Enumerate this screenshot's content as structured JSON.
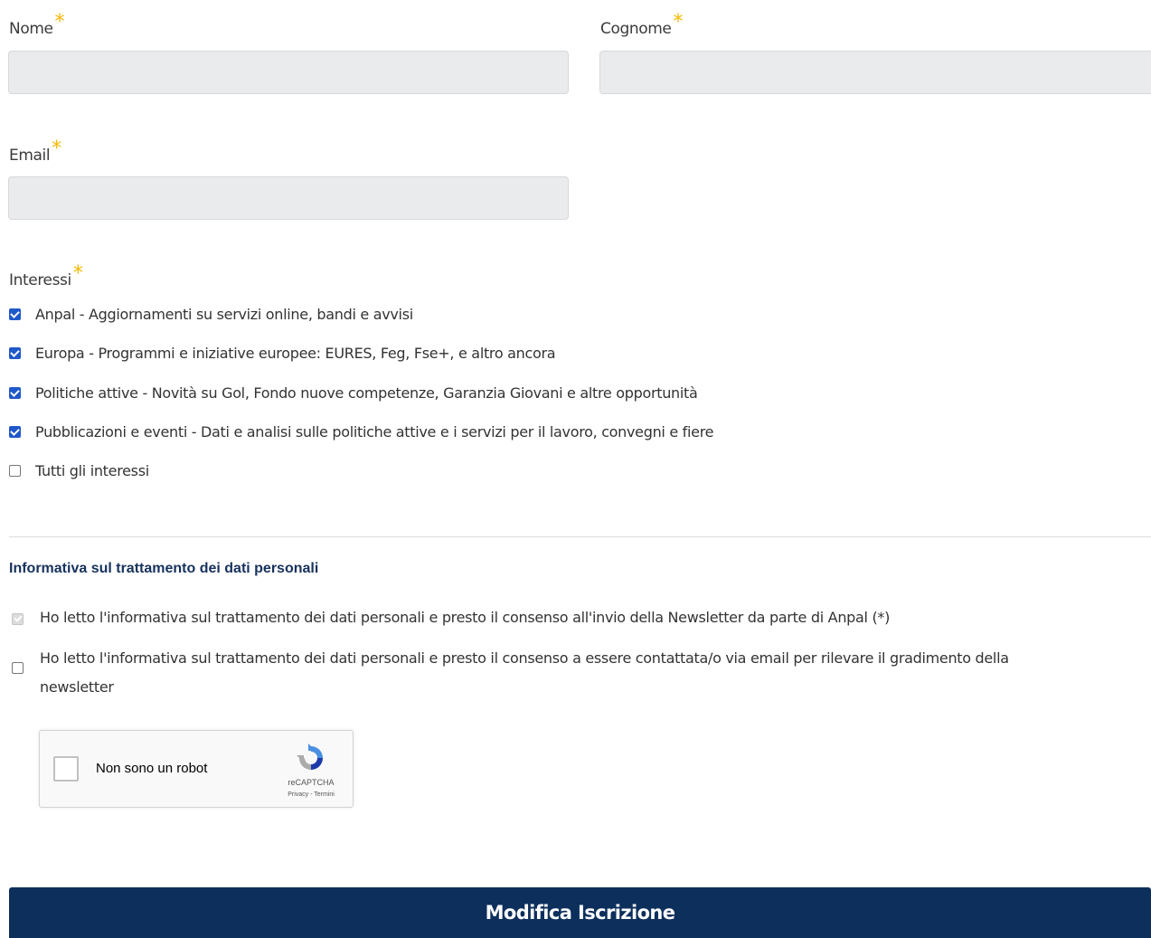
{
  "form": {
    "nome_label": "Nome",
    "nome_value": "",
    "cognome_label": "Cognome",
    "cognome_value": "",
    "email_label": "Email",
    "email_value": "",
    "required_mark": "*",
    "interessi_label": "Interessi",
    "interessi": [
      {
        "label": "Anpal - Aggiornamenti su servizi online, bandi e avvisi",
        "checked": true
      },
      {
        "label": "Europa - Programmi e iniziative europee: EURES, Feg, Fse+, e altro ancora",
        "checked": true
      },
      {
        "label": "Politiche attive - Novità su Gol, Fondo nuove competenze, Garanzia Giovani e altre opportunità",
        "checked": true
      },
      {
        "label": "Pubblicazioni e eventi - Dati e analisi sulle politiche attive e i servizi per il lavoro, convegni e fiere",
        "checked": true
      },
      {
        "label": "Tutti gli interessi",
        "checked": false
      }
    ]
  },
  "privacy": {
    "title": "Informativa sul trattamento dei dati personali",
    "consent_newsletter": "Ho letto l'informativa sul trattamento dei dati personali e presto il consenso all'invio della Newsletter da parte di Anpal (*)",
    "consent_newsletter_checked": true,
    "consent_newsletter_disabled": true,
    "consent_survey_line1": "Ho letto l'informativa sul trattamento dei dati personali e presto il consenso a essere contattata/o via email per rilevare il gradimento della",
    "consent_survey_line2": "newsletter",
    "consent_survey_checked": false
  },
  "recaptcha": {
    "label": "Non sono un robot",
    "brand": "reCAPTCHA",
    "privacy_link": "Privacy",
    "separator": " - ",
    "terms_link": "Termini"
  },
  "submit_label": "Modifica Iscrizione",
  "colors": {
    "accent": "#1f58c9",
    "required_star": "#f5b800",
    "primary_button": "#0d2f5c",
    "section_title": "#17325c"
  }
}
